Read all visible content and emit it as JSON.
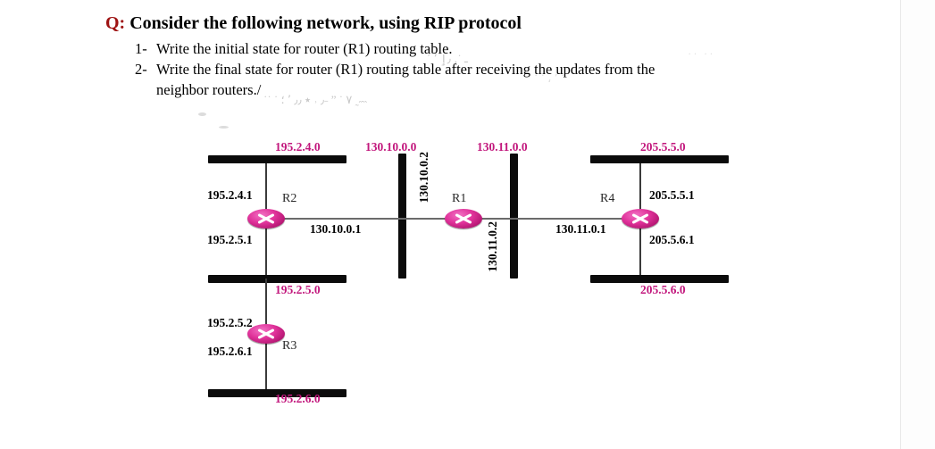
{
  "document": {
    "title_prefix": "Q:",
    "title_text": "Consider the following network, using RIP protocol",
    "questions": [
      {
        "number": "1-",
        "text": "Write the initial state for router (R1) routing table."
      },
      {
        "number": "2-",
        "text": "Write the final state for router (R1) routing table after receiving the updates from the",
        "continuation": "neighbor routers./"
      }
    ]
  },
  "diagram": {
    "type": "network-topology",
    "accent_color": "#c2187d",
    "bus_color": "#0b0b0b",
    "router_color": "#e0329a",
    "routers": [
      {
        "id": "R2",
        "label": "R2"
      },
      {
        "id": "R3",
        "label": "R3"
      },
      {
        "id": "R1",
        "label": "R1"
      },
      {
        "id": "R4",
        "label": "R4"
      }
    ],
    "networks": [
      {
        "id": "net-195-2-4-0",
        "label": "195.2.4.0",
        "orientation": "horizontal"
      },
      {
        "id": "net-195-2-5-0",
        "label": "195.2.5.0",
        "orientation": "horizontal"
      },
      {
        "id": "net-195-2-6-0",
        "label": "195.2.6.0",
        "orientation": "horizontal"
      },
      {
        "id": "net-130-10-0-0",
        "label": "130.10.0.0",
        "orientation": "vertical"
      },
      {
        "id": "net-130-11-0-0",
        "label": "130.11.0.0",
        "orientation": "vertical"
      },
      {
        "id": "net-205-5-5-0",
        "label": "205.5.5.0",
        "orientation": "horizontal"
      },
      {
        "id": "net-205-5-6-0",
        "label": "205.5.6.0",
        "orientation": "horizontal"
      }
    ],
    "interfaces": [
      {
        "id": "if-195-2-4-1",
        "label": "195.2.4.1",
        "router": "R2",
        "network": "195.2.4.0"
      },
      {
        "id": "if-195-2-5-1",
        "label": "195.2.5.1",
        "router": "R2",
        "network": "195.2.5.0"
      },
      {
        "id": "if-130-10-0-1",
        "label": "130.10.0.1",
        "router": "R2",
        "network": "130.10.0.0"
      },
      {
        "id": "if-195-2-5-2",
        "label": "195.2.5.2",
        "router": "R3",
        "network": "195.2.5.0"
      },
      {
        "id": "if-195-2-6-1",
        "label": "195.2.6.1",
        "router": "R3",
        "network": "195.2.6.0"
      },
      {
        "id": "if-130-10-0-2",
        "label": "130.10.0.2",
        "router": "R1",
        "network": "130.10.0.0"
      },
      {
        "id": "if-130-11-0-2",
        "label": "130.11.0.2",
        "router": "R1",
        "network": "130.11.0.0"
      },
      {
        "id": "if-130-11-0-1",
        "label": "130.11.0.1",
        "router": "R4",
        "network": "130.11.0.0"
      },
      {
        "id": "if-205-5-5-1",
        "label": "205.5.5.1",
        "router": "R4",
        "network": "205.5.5.0"
      },
      {
        "id": "if-205-5-6-1",
        "label": "205.5.6.1",
        "router": "R4",
        "network": "205.5.6.0"
      }
    ]
  }
}
